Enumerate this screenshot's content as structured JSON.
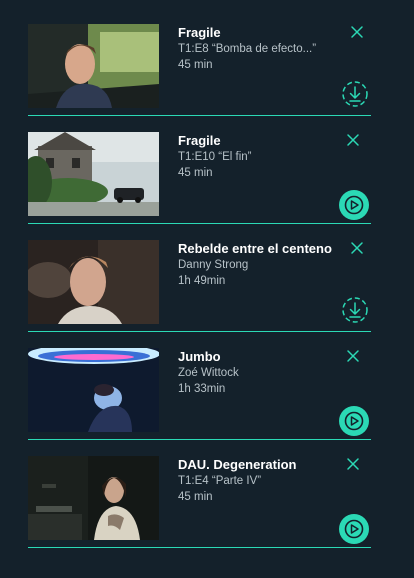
{
  "colors": {
    "background": "#14212b",
    "accent": "#2bd9b5",
    "title": "#ffffff",
    "subtitle": "#b7c2c8"
  },
  "items": [
    {
      "title": "Fragile",
      "subtitle": "T1:E8 “Bomba de efecto...”",
      "duration": "45 min",
      "action_icon": "download-icon",
      "thumbnail": "man-driving-car"
    },
    {
      "title": "Fragile",
      "subtitle": "T1:E10 “El fin”",
      "duration": "45 min",
      "action_icon": "play-icon",
      "thumbnail": "house-with-car"
    },
    {
      "title": "Rebelde entre el centeno",
      "subtitle": "Danny Strong",
      "duration": "1h 49min",
      "action_icon": "download-icon",
      "thumbnail": "man-smoking"
    },
    {
      "title": "Jumbo",
      "subtitle": "Zoé Wittock",
      "duration": "1h 33min",
      "action_icon": "play-icon",
      "thumbnail": "woman-under-lights"
    },
    {
      "title": "DAU. Degeneration",
      "subtitle": "T1:E4 “Parte IV”",
      "duration": "45 min",
      "action_icon": "play-icon",
      "thumbnail": "woman-at-desk"
    }
  ]
}
